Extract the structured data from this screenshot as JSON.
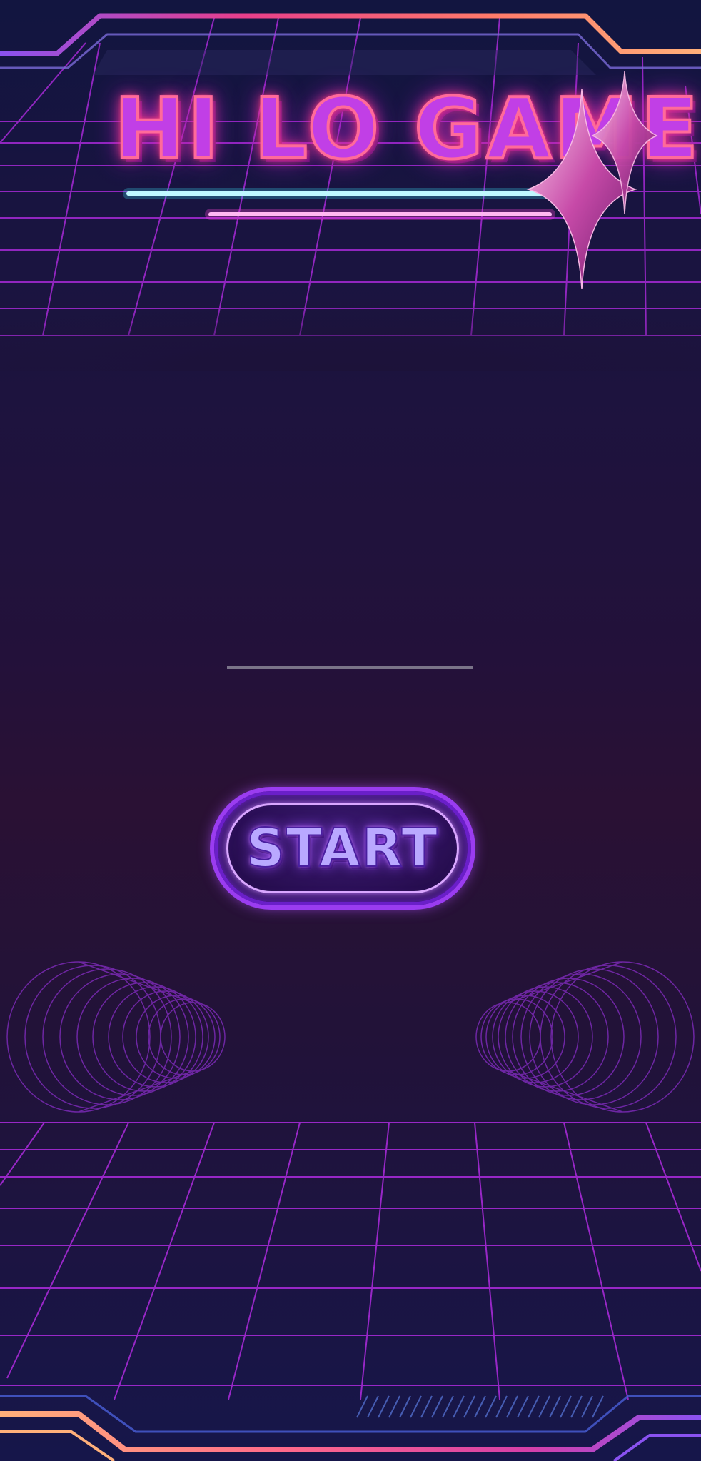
{
  "title": "HI LO GAME",
  "start_button": {
    "label": "START"
  },
  "progress": {
    "value": 1.0
  },
  "colors": {
    "grid": "#a62ad6",
    "neon_cyan": "#3fe9ff",
    "neon_pink": "#ff45d8",
    "frame_gradient_start": "#ff9a6a",
    "frame_gradient_end": "#8a52f0",
    "title_fill": "#c13fe6",
    "title_outline": "#ff6a9a"
  },
  "icons": {
    "sparkle": "four-point-star-icon",
    "speaker_left": "concentric-rings-left",
    "speaker_right": "concentric-rings-right"
  }
}
